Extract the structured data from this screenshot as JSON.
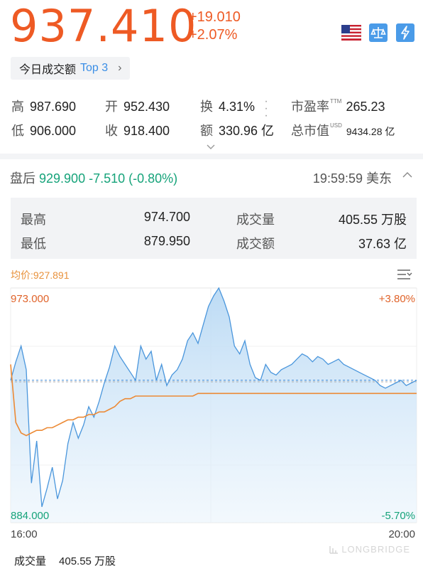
{
  "quote": {
    "price": "937.410",
    "change_abs": "+19.010",
    "change_pct": "+2.07%",
    "up_color": "#ee5a24"
  },
  "header_icons": [
    "us-flag-icon",
    "balance-scale-icon",
    "lightning-icon"
  ],
  "top_volume_pill": {
    "label": "今日成交额",
    "rank": "Top 3",
    "chevron": "›"
  },
  "stats": {
    "high_label": "高",
    "high_value": "987.690",
    "low_label": "低",
    "low_value": "906.000",
    "open_label": "开",
    "open_value": "952.430",
    "close_label": "收",
    "close_value": "918.400",
    "turnover_label": "换",
    "turnover_value": "4.31%",
    "amount_label": "额",
    "amount_value": "330.96 亿",
    "pe_label": "市盈率",
    "pe_sup": "TTM",
    "pe_value": "265.23",
    "mcap_label": "总市值",
    "mcap_sup": "USD",
    "mcap_value": "9434.28 亿"
  },
  "after_hours": {
    "label": "盘后",
    "price": "929.900",
    "change": "-7.510 (-0.80%)",
    "time": "19:59:59 美东",
    "high_label": "最高",
    "high_value": "974.700",
    "low_label": "最低",
    "low_value": "879.950",
    "volume_label": "成交量",
    "volume_value": "405.55 万股",
    "amount_label": "成交额",
    "amount_value": "37.63 亿",
    "down_color": "#16a37a"
  },
  "chart_header": {
    "avg_label": "均价:927.891"
  },
  "chart_data": {
    "type": "line",
    "x_start_label": "16:00",
    "x_end_label": "20:00",
    "y_max_label": "973.000",
    "y_min_label": "884.000",
    "pct_max_label": "+3.80%",
    "pct_min_label": "-5.70%",
    "ylim": [
      884.0,
      973.0
    ],
    "reference_prev_close": 937.41,
    "reference_avg": 927.891,
    "series": [
      {
        "values": [
          938,
          945,
          951,
          942,
          899,
          915,
          890,
          897,
          905,
          893,
          900,
          914,
          922,
          916,
          921,
          928,
          924,
          930,
          937,
          943,
          951,
          947,
          944,
          941,
          938,
          951,
          946,
          949,
          938,
          944,
          936,
          940,
          942,
          946,
          953,
          956,
          952,
          959,
          966,
          970,
          973,
          968,
          962,
          951,
          948,
          953,
          944,
          939,
          938,
          944,
          941,
          940,
          942,
          943,
          944,
          946,
          948,
          947,
          945,
          947,
          946,
          944,
          945,
          946,
          944,
          943,
          942,
          941,
          940,
          939,
          938,
          936,
          935,
          936,
          937,
          938,
          936,
          937,
          938
        ]
      },
      {
        "values": [
          944,
          922,
          918,
          917,
          918,
          919,
          919,
          920,
          920,
          921,
          922,
          923,
          923,
          924,
          924,
          925,
          925,
          926,
          926,
          927,
          928,
          930,
          931,
          931,
          932,
          932,
          932,
          932,
          932,
          932,
          932,
          932,
          932,
          932,
          932,
          932,
          933,
          933,
          933,
          933,
          933,
          933,
          933,
          933,
          933,
          933,
          933,
          933,
          933,
          933,
          933,
          933,
          933,
          933,
          933,
          933,
          933,
          933,
          933,
          933,
          933,
          933,
          933,
          933,
          933,
          933,
          933,
          933,
          933,
          933,
          933,
          933,
          933,
          933,
          933,
          933,
          933,
          933,
          933
        ]
      }
    ]
  },
  "volume": {
    "label": "成交量",
    "value": "405.55 万股"
  },
  "watermark": "LONGBRIDGE"
}
